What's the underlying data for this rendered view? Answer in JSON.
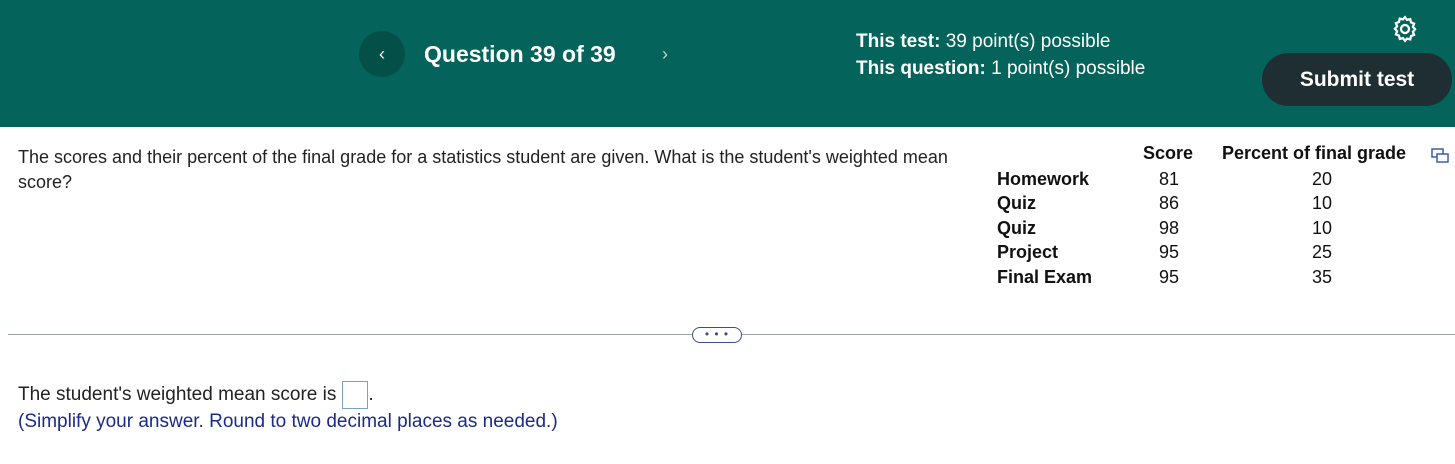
{
  "header": {
    "question_label": "Question 39 of 39",
    "prev_icon": "chevron-left-icon",
    "next_icon": "chevron-right-icon",
    "test_points_label": "This test:",
    "test_points_value": "39 point(s) possible",
    "question_points_label": "This question:",
    "question_points_value": "1 point(s) possible",
    "submit_label": "Submit test",
    "settings_icon": "gear-icon",
    "colors": {
      "header_bg": "#04635a",
      "submit_bg": "#1f2e33"
    }
  },
  "question": {
    "text": "The scores and their percent of the final grade for a statistics student are given. What is the student's weighted mean score?"
  },
  "table": {
    "headers": {
      "score": "Score",
      "percent": "Percent of final grade"
    },
    "rows": [
      {
        "label": "Homework",
        "score": "81",
        "percent": "20"
      },
      {
        "label": "Quiz",
        "score": "86",
        "percent": "10"
      },
      {
        "label": "Quiz",
        "score": "98",
        "percent": "10"
      },
      {
        "label": "Project",
        "score": "95",
        "percent": "25"
      },
      {
        "label": "Final Exam",
        "score": "95",
        "percent": "35"
      }
    ]
  },
  "divider": {
    "more_label": "• • •"
  },
  "answer": {
    "prefix": "The student's weighted mean score is",
    "suffix": ".",
    "hint": "(Simplify your answer. Round to two decimal places as needed.)"
  }
}
